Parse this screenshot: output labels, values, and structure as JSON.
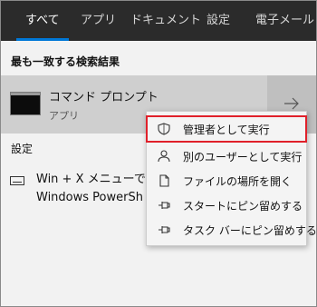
{
  "tabs": [
    {
      "label": "すべて",
      "active": true
    },
    {
      "label": "アプリ"
    },
    {
      "label": "ドキュメント"
    },
    {
      "label": "設定"
    },
    {
      "label": "電子メール"
    }
  ],
  "best_match": {
    "section_title": "最も一致する検索結果",
    "name": "コマンド プロンプト",
    "type": "アプリ",
    "icon": "command-prompt-icon"
  },
  "settings": {
    "section_title": "設定",
    "item_line1": "Win + X メニューでは",
    "item_line2": "Windows PowerSh",
    "icon": "keyboard-icon"
  },
  "context_menu": {
    "items": [
      {
        "label": "管理者として実行",
        "icon": "shield-icon",
        "highlighted": true
      },
      {
        "label": "別のユーザーとして実行",
        "icon": "user-icon"
      },
      {
        "label": "ファイルの場所を開く",
        "icon": "file-icon"
      },
      {
        "label": "スタートにピン留めする",
        "icon": "pin-icon"
      },
      {
        "label": "タスク バーにピン留めする",
        "icon": "pin-icon"
      }
    ]
  },
  "colors": {
    "tab_bar": "#2b2b2b",
    "accent": "#0078d7",
    "highlight_border": "#e0202a"
  }
}
